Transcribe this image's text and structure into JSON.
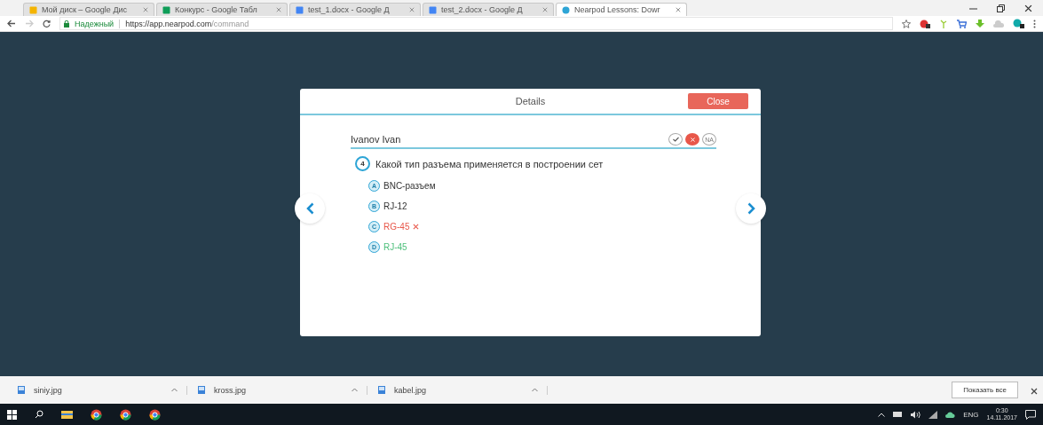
{
  "browser": {
    "tabs": [
      {
        "title": "Мой диск – Google Дис",
        "kind": "drive",
        "selected": false
      },
      {
        "title": "Конкурс - Google Табл",
        "kind": "sheet",
        "selected": false
      },
      {
        "title": "test_1.docx - Google Д",
        "kind": "doc",
        "selected": false
      },
      {
        "title": "test_2.docx - Google Д",
        "kind": "doc",
        "selected": false
      },
      {
        "title": "Nearpod Lessons: Dowr",
        "kind": "web",
        "selected": true
      }
    ],
    "secure_label": "Надежный",
    "url_host": "https://app.nearpod.com",
    "url_path": "/command"
  },
  "modal": {
    "title": "Details",
    "close": "Close",
    "student": "Ivanov Ivan",
    "marks": [
      {
        "kind": "correct",
        "selected": false
      },
      {
        "kind": "wrong",
        "selected": true
      },
      {
        "kind": "na",
        "label": "NA",
        "selected": false
      }
    ],
    "question": {
      "number": "4",
      "text": "Какой тип разъема применяется в построении сет"
    },
    "answers": [
      {
        "letter": "A",
        "text": "BNC-разъем",
        "kind": "plain"
      },
      {
        "letter": "B",
        "text": "RJ-12",
        "kind": "plain"
      },
      {
        "letter": "C",
        "text": "RG-45",
        "kind": "wrong"
      },
      {
        "letter": "D",
        "text": "RJ-45",
        "kind": "correct"
      }
    ]
  },
  "downloads": {
    "items": [
      "siniy.jpg",
      "kross.jpg",
      "kabel.jpg"
    ],
    "show_all": "Показать все"
  },
  "taskbar": {
    "language": "ENG",
    "time": "0:30",
    "date": "14.11.2017"
  }
}
